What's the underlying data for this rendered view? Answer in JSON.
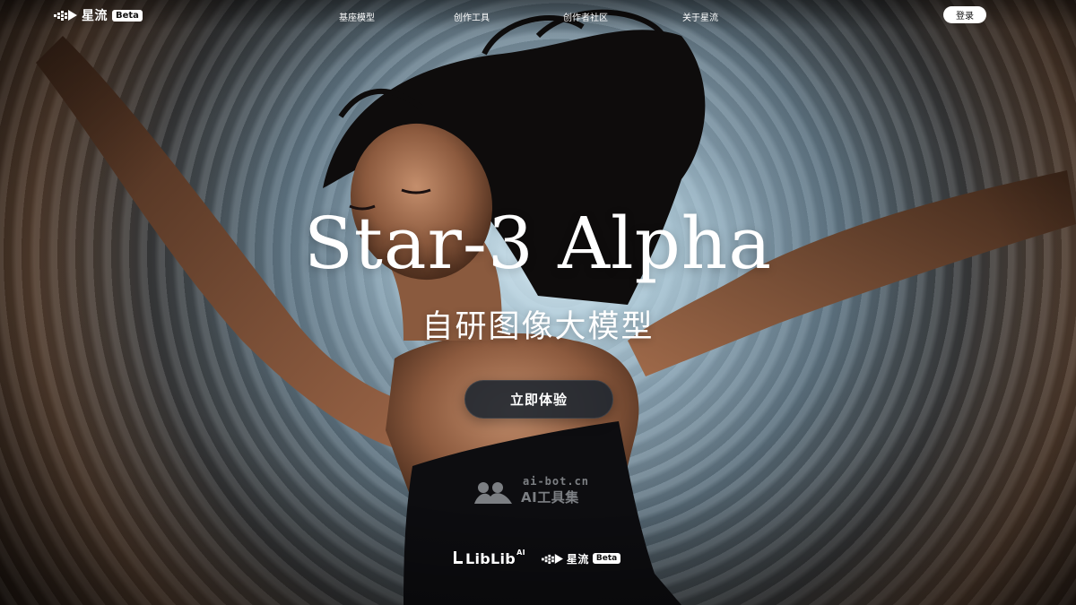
{
  "brand": {
    "name": "星流",
    "badge": "Beta",
    "icon": "pixel-star-logo-icon"
  },
  "nav": {
    "items": [
      {
        "label": "基座模型"
      },
      {
        "label": "创作工具"
      },
      {
        "label": "创作者社区"
      },
      {
        "label": "关于星流"
      }
    ],
    "login_label": "登录"
  },
  "hero": {
    "title": "Star-3 Alpha",
    "subtitle": "自研图像大模型",
    "cta_label": "立即体验",
    "background_image": "woman-floating-in-radial-motion-tunnel"
  },
  "watermark": {
    "domain": "ai-bot.cn",
    "name": "AI工具集",
    "icon": "ai-bot-logo-icon"
  },
  "footer": {
    "partner_logo_text": "LibLib",
    "partner_logo_suffix": "AI",
    "brand_name": "星流",
    "brand_badge": "Beta"
  },
  "colors": {
    "cta_background": "#1c2630",
    "text": "#ffffff",
    "login_background": "#ffffff"
  }
}
